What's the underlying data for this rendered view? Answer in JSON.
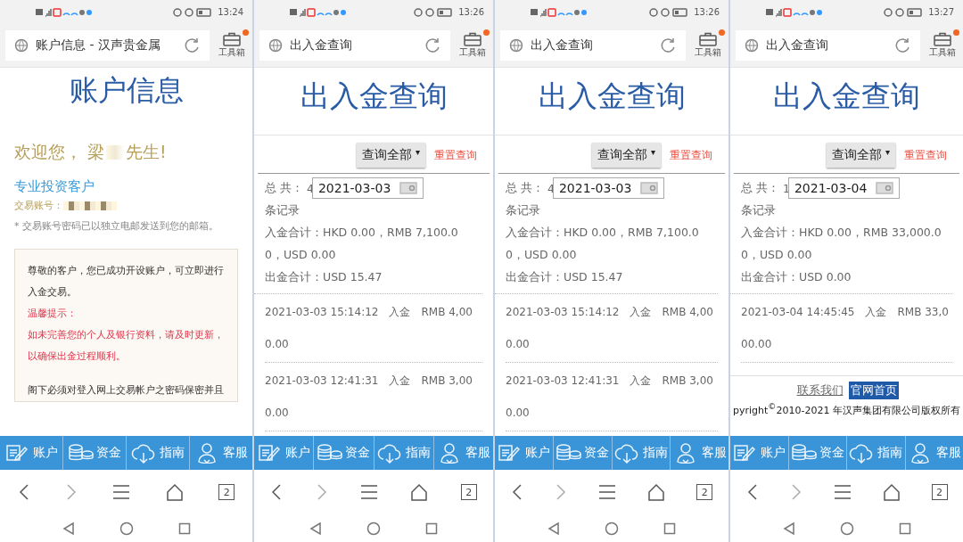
{
  "screens": [
    {
      "kind": "account",
      "status_time": "13:24",
      "address_title": "账户信息 - 汉声贵金属",
      "toolbox": {
        "label": "工具箱",
        "badge": true
      },
      "heading": "账户信息",
      "greeting_before": "欢迎您， 梁",
      "greeting_after": "先生!",
      "client_type": "专业投资客户",
      "account_label": "交易账号：",
      "note": "* 交易账号密码已以独立电邮发送到您的邮箱。",
      "notice": [
        {
          "kind": "normal",
          "text": "尊敬的客户，您已成功开设账户，可立即进行入金交易。"
        },
        {
          "kind": "warning",
          "text": "温馨提示："
        },
        {
          "kind": "warning",
          "text": "如未完善您的个人及银行资料，请及时更新，"
        },
        {
          "kind": "warning",
          "text": "以确保出金过程顺利。"
        }
      ],
      "notice_more": "阁下必须对登入网上交易帐户之密码保密并且",
      "bottom_tabs": [
        {
          "label": "账户"
        },
        {
          "label": "资金"
        },
        {
          "label": "指南"
        },
        {
          "label": "客服"
        }
      ],
      "tab_count": "2"
    },
    {
      "kind": "query",
      "status_time": "13:26",
      "address_title": "出入金查询",
      "toolbox": {
        "label": "工具箱",
        "badge": true
      },
      "heading": "出入金查询",
      "filter": "查询全部",
      "caret": "▾",
      "reset": "重置查询",
      "total_label": "总 共：",
      "total_count": "4",
      "date": "2021-03-03",
      "records_label": "条记录",
      "deposit_total": "入金合计：HKD 0.00，RMB 7,100.00，USD 0.00",
      "withdraw_total": "出金合计：USD 15.47",
      "records": [
        {
          "text": "2021-03-03 15:14:12　入金　RMB 4,000.00"
        },
        {
          "text": "2021-03-03 12:41:31　入金　RMB 3,000.00"
        }
      ],
      "bottom_tabs": [
        {
          "label": "账户"
        },
        {
          "label": "资金"
        },
        {
          "label": "指南"
        },
        {
          "label": "客服"
        }
      ],
      "tab_count": "2"
    },
    {
      "kind": "query",
      "status_time": "13:26",
      "address_title": "出入金查询",
      "toolbox": {
        "label": "工具箱",
        "badge": true
      },
      "heading": "出入金查询",
      "filter": "查询全部",
      "caret": "▾",
      "reset": "重置查询",
      "total_label": "总 共：",
      "total_count": "4",
      "date": "2021-03-03",
      "records_label": "条记录",
      "deposit_total": "入金合计：HKD 0.00，RMB 7,100.00，USD 0.00",
      "withdraw_total": "出金合计：USD 15.47",
      "records": [
        {
          "text": "2021-03-03 15:14:12　入金　RMB 4,000.00"
        },
        {
          "text": "2021-03-03 12:41:31　入金　RMB 3,000.00"
        }
      ],
      "bottom_tabs": [
        {
          "label": "账户"
        },
        {
          "label": "资金"
        },
        {
          "label": "指南"
        },
        {
          "label": "客服"
        }
      ],
      "tab_count": "2"
    },
    {
      "kind": "query",
      "status_time": "13:27",
      "address_title": "出入金查询",
      "toolbox": {
        "label": "工具箱",
        "badge": true
      },
      "heading": "出入金查询",
      "filter": "查询全部",
      "caret": "▾",
      "reset": "重置查询",
      "total_label": "总 共：",
      "total_count": "1",
      "date": "2021-03-04",
      "records_label": "条记录",
      "deposit_total": "入金合计：HKD 0.00，RMB 33,000.00，USD 0.00",
      "withdraw_total": "出金合计：USD 0.00",
      "records": [
        {
          "text": "2021-03-04 14:45:45　入金　RMB 33,000.00"
        }
      ],
      "footer": {
        "links": [
          {
            "label": "联系我们",
            "highlighted": false
          },
          {
            "label": "官网首页",
            "highlighted": true
          }
        ],
        "copyright": "pyright$^{©}$2010-2021 年汉声集团有限公司版权所有"
      },
      "bottom_tabs": [
        {
          "label": "账户"
        },
        {
          "label": "资金"
        },
        {
          "label": "指南"
        },
        {
          "label": "客服"
        }
      ],
      "tab_count": "2"
    }
  ]
}
